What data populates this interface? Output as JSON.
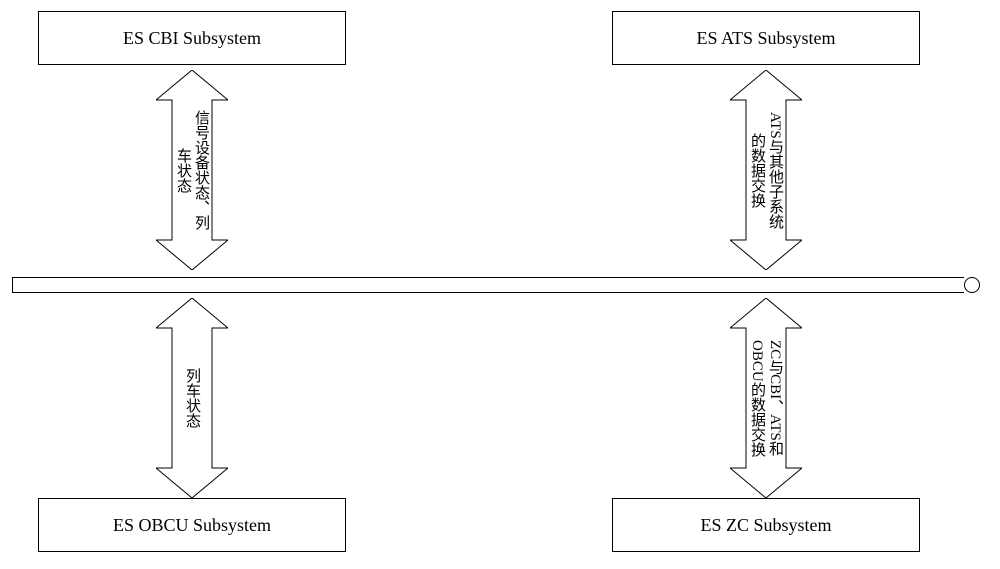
{
  "subsystems": {
    "top_left": "ES CBI Subsystem",
    "top_right": "ES ATS Subsystem",
    "bottom_left": "ES OBCU Subsystem",
    "bottom_right": "ES ZC Subsystem"
  },
  "arrows": {
    "top_left": {
      "line1": "信号设备状态、列",
      "line2": "车状态"
    },
    "top_right": {
      "line1": "ATS与其他子系统",
      "line2": "的数据交换"
    },
    "bottom_left": {
      "line1": "列车状态"
    },
    "bottom_right": {
      "line1": "ZC与CBI、ATS和",
      "line2": "OBCU的数据交换"
    }
  }
}
